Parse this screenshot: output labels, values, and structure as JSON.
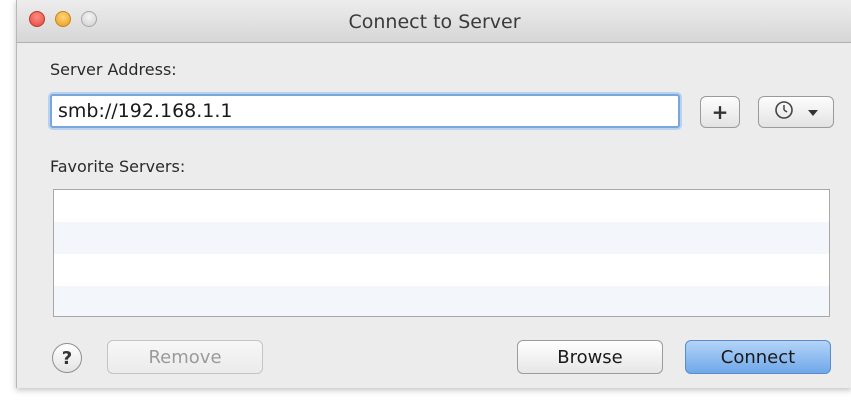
{
  "window": {
    "title": "Connect to Server",
    "traffic_lights": [
      "close",
      "minimize",
      "zoom"
    ]
  },
  "server_address": {
    "label": "Server Address:",
    "value": "smb://192.168.1.1",
    "add_button_label": "+",
    "recent_icon": "clock-icon"
  },
  "favorites": {
    "label": "Favorite Servers:",
    "items": []
  },
  "buttons": {
    "help_label": "?",
    "remove_label": "Remove",
    "browse_label": "Browse",
    "connect_label": "Connect"
  },
  "colors": {
    "accent": "#6fa8ea",
    "focus_ring": "#7aa7d9"
  }
}
